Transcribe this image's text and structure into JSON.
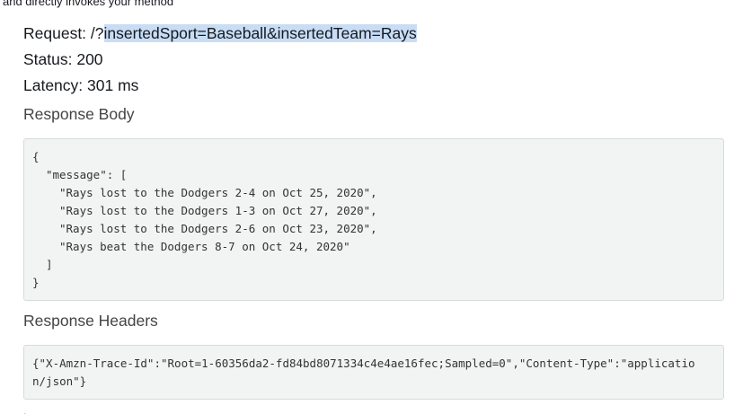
{
  "intro_text": "and directly invokes your method",
  "request": {
    "label": "Request: ",
    "path": "/?",
    "query": "insertedSport=Baseball&insertedTeam=Rays"
  },
  "status": "Status: 200",
  "latency": "Latency: 301 ms",
  "response_body": {
    "heading": "Response Body",
    "lines": [
      "{",
      "\"message\": [",
      "\"Rays lost to the Dodgers 2-4 on Oct 25, 2020\",",
      "\"Rays lost to the Dodgers 1-3 on Oct 27, 2020\",",
      "\"Rays lost to the Dodgers 2-6 on Oct 23, 2020\",",
      "\"Rays beat the Dodgers 8-7 on Oct 24, 2020\"",
      "]",
      "}"
    ]
  },
  "response_headers": {
    "heading": "Response Headers",
    "lines": [
      "{\"X-Amzn-Trace-Id\":\"Root=1-60356da2-fd84bd8071334c4e4ae16fec;Sampled=0\",\"Content-Type\":\"applicatio",
      "n/json\"}"
    ]
  },
  "trailing_mark": "."
}
